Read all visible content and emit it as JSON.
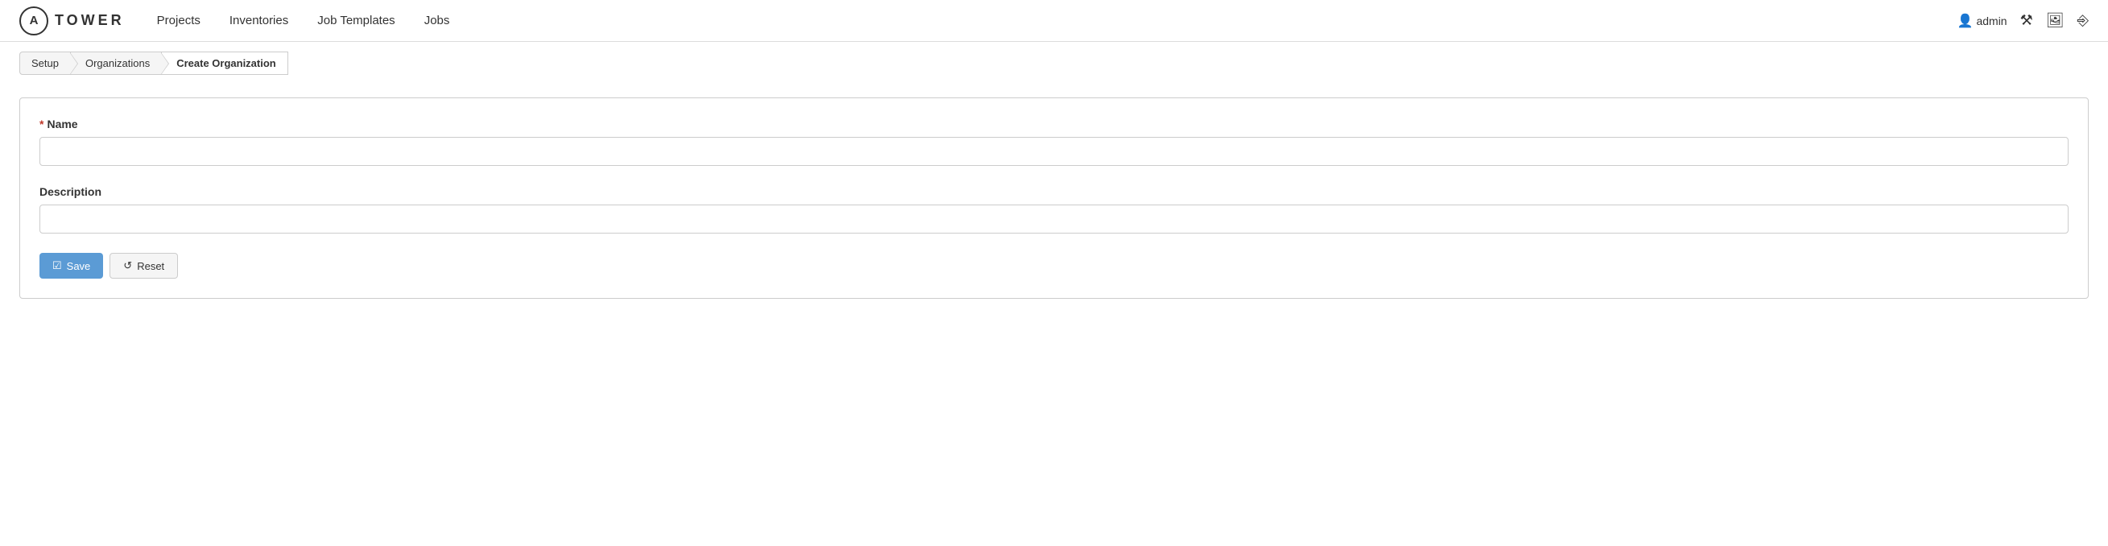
{
  "logo": {
    "letter": "A",
    "text": "TOWER"
  },
  "nav": {
    "items": [
      {
        "label": "Projects",
        "href": "#"
      },
      {
        "label": "Inventories",
        "href": "#"
      },
      {
        "label": "Job Templates",
        "href": "#"
      },
      {
        "label": "Jobs",
        "href": "#"
      }
    ]
  },
  "header": {
    "username": "admin",
    "icons": {
      "user": "👤",
      "wrench": "🔧",
      "monitor": "🖥",
      "logout": "⬛"
    }
  },
  "breadcrumb": {
    "items": [
      {
        "label": "Setup",
        "active": false
      },
      {
        "label": "Organizations",
        "active": false
      },
      {
        "label": "Create Organization",
        "active": true
      }
    ]
  },
  "form": {
    "name_label": "Name",
    "name_placeholder": "",
    "description_label": "Description",
    "description_placeholder": "",
    "required_indicator": "*",
    "save_label": "Save",
    "reset_label": "Reset"
  }
}
